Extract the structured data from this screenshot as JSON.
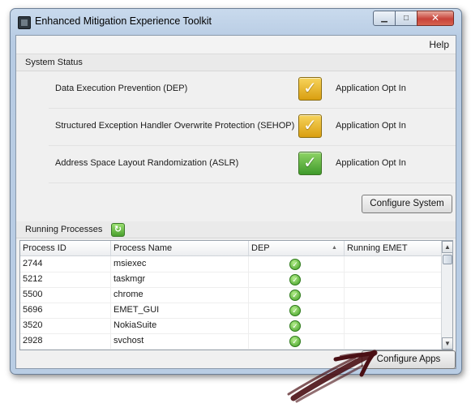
{
  "window": {
    "title": "Enhanced Mitigation Experience Toolkit",
    "minimize_glyph": "▁",
    "maximize_glyph": "□",
    "close_glyph": "✕"
  },
  "menu": {
    "help": "Help"
  },
  "system_status": {
    "header": "System Status",
    "items": [
      {
        "name": "Data Execution Prevention (DEP)",
        "value": "Application Opt In",
        "indicator": "yellow-check-icon"
      },
      {
        "name": "Structured Exception Handler Overwrite Protection (SEHOP)",
        "value": "Application Opt In",
        "indicator": "yellow-check-icon"
      },
      {
        "name": "Address Space Layout Randomization (ASLR)",
        "value": "Application Opt In",
        "indicator": "green-check-icon"
      }
    ],
    "configure_button": "Configure System"
  },
  "running_processes": {
    "header": "Running Processes",
    "columns": [
      "Process ID",
      "Process Name",
      "DEP",
      "Running EMET"
    ],
    "rows": [
      {
        "pid": "2744",
        "name": "msiexec",
        "dep": "enabled-check-icon",
        "emet": ""
      },
      {
        "pid": "5212",
        "name": "taskmgr",
        "dep": "enabled-check-icon",
        "emet": ""
      },
      {
        "pid": "5500",
        "name": "chrome",
        "dep": "enabled-check-icon",
        "emet": ""
      },
      {
        "pid": "5696",
        "name": "EMET_GUI",
        "dep": "enabled-check-icon",
        "emet": ""
      },
      {
        "pid": "3520",
        "name": "NokiaSuite",
        "dep": "enabled-check-icon",
        "emet": ""
      },
      {
        "pid": "2928",
        "name": "svchost",
        "dep": "enabled-check-icon",
        "emet": ""
      }
    ],
    "configure_button": "Configure Apps"
  },
  "glyphs": {
    "check": "✓",
    "refresh": "↻",
    "sort_up": "▲",
    "scroll_up": "▲",
    "scroll_down": "▼"
  },
  "colors": {
    "yellow_check": "#e0b020",
    "green_check": "#4aa02e",
    "annotation_arrow": "#4a0f14"
  }
}
